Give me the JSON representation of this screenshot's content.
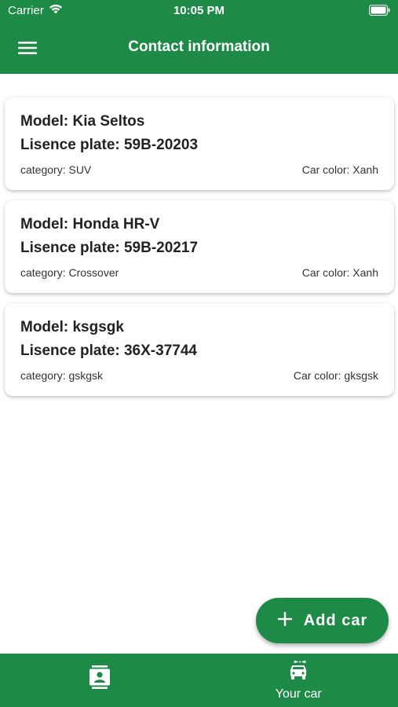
{
  "status_bar": {
    "carrier": "Carrier",
    "time": "10:05 PM"
  },
  "header": {
    "title": "Contact information",
    "menu_icon": "hamburger-menu-icon"
  },
  "cars": [
    {
      "model": "Model: Kia Seltos",
      "plate": "Lisence plate: 59B-20203",
      "category": "category: SUV",
      "color": "Car color: Xanh"
    },
    {
      "model": "Model: Honda HR-V",
      "plate": "Lisence plate: 59B-20217",
      "category": "category: Crossover",
      "color": "Car color: Xanh"
    },
    {
      "model": "Model: ksgsgk",
      "plate": "Lisence plate: 36X-37744",
      "category": "category: gskgsk",
      "color": "Car color: gksgsk"
    }
  ],
  "fab": {
    "label": "Add car",
    "icon": "plus-icon"
  },
  "bottom_nav": {
    "items": [
      {
        "icon": "contact-card-icon",
        "label": ""
      },
      {
        "icon": "car-icon",
        "label": "Your car"
      }
    ]
  },
  "colors": {
    "primary": "#1e8a47",
    "background": "#ffffff",
    "card_text": "#222222"
  }
}
